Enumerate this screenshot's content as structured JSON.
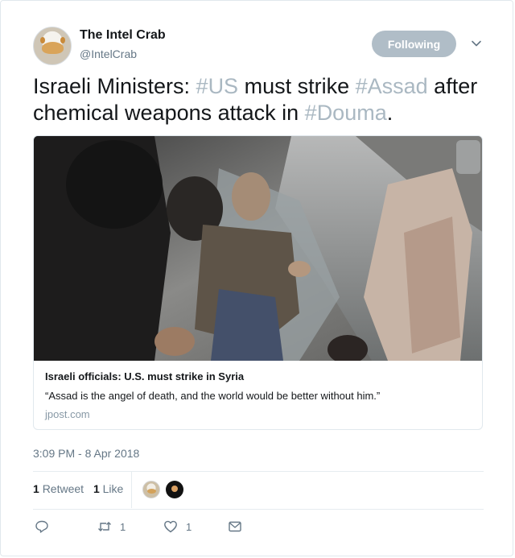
{
  "author": {
    "display_name": "The Intel Crab",
    "handle": "@IntelCrab"
  },
  "follow_button": {
    "label": "Following"
  },
  "tweet": {
    "parts": [
      {
        "text": "Israeli Ministers: ",
        "hashtag": false
      },
      {
        "text": "#US",
        "hashtag": true
      },
      {
        "text": " must strike ",
        "hashtag": false
      },
      {
        "text": "#Assad",
        "hashtag": true
      },
      {
        "text": " after chemical weapons attack in ",
        "hashtag": false
      },
      {
        "text": "#Douma",
        "hashtag": true
      },
      {
        "text": ".",
        "hashtag": false
      }
    ]
  },
  "link_card": {
    "title": "Israeli officials: U.S. must strike in Syria",
    "description": "“Assad is the angel of death, and the world would be better without him.”",
    "domain": "jpost.com"
  },
  "timestamp": "3:09 PM - 8 Apr 2018",
  "stats": {
    "retweets_count": "1",
    "retweets_label": "Retweet",
    "likes_count": "1",
    "likes_label": "Like"
  },
  "actions": {
    "retweet_count": "1",
    "like_count": "1"
  },
  "colors": {
    "hashtag": "#aab8c2",
    "follow_button_bg": "#b0bdc7",
    "secondary_text": "#657786"
  },
  "icons": [
    "caret-down-icon",
    "reply-icon",
    "retweet-icon",
    "heart-icon",
    "direct-message-icon"
  ]
}
